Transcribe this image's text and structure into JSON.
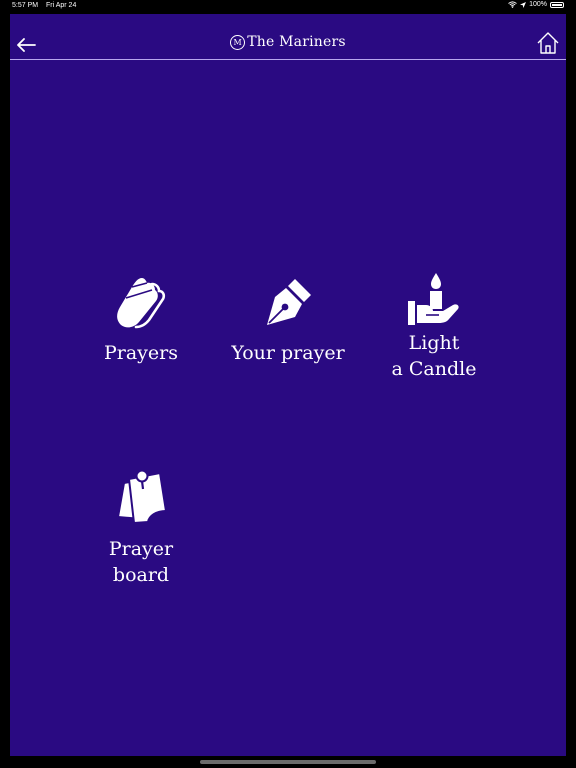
{
  "status_bar": {
    "time": "5:57 PM",
    "date": "Fri Apr 24",
    "battery": "100%"
  },
  "header": {
    "logo_letter": "M",
    "title": "The Mariners"
  },
  "tiles": [
    {
      "icon": "praying-hands-icon",
      "label": "Prayers"
    },
    {
      "icon": "fountain-pen-icon",
      "label": "Your prayer"
    },
    {
      "icon": "candle-in-hand-icon",
      "label_line1": "Light",
      "label_line2": "a Candle"
    },
    {
      "icon": "pinned-notes-icon",
      "label_line1": "Prayer",
      "label_line2": "board"
    }
  ],
  "colors": {
    "background": "#2a0a82",
    "text": "#ffffff",
    "header_rule": "#b8a8ee"
  }
}
